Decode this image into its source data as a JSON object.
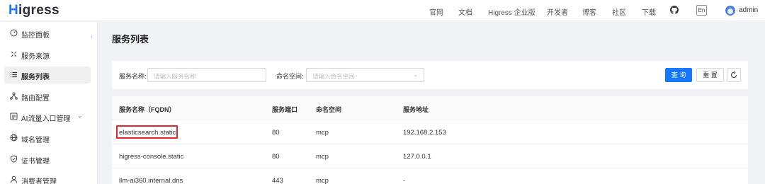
{
  "header": {
    "logo_first": "H",
    "logo_rest": "igress",
    "nav": [
      "官网",
      "文档",
      "Higress 企业版",
      "开发者",
      "博客",
      "社区",
      "下载"
    ],
    "github_icon": "github-icon",
    "lang_label": "En",
    "username": "admin"
  },
  "sidebar": {
    "items": [
      {
        "label": "监控面板",
        "icon": "dashboard-icon"
      },
      {
        "label": "服务来源",
        "icon": "service-source-icon"
      },
      {
        "label": "服务列表",
        "icon": "list-icon"
      },
      {
        "label": "路由配置",
        "icon": "route-icon"
      },
      {
        "label": "AI流量入口管理",
        "icon": "ai-icon"
      },
      {
        "label": "域名管理",
        "icon": "globe-icon"
      },
      {
        "label": "证书管理",
        "icon": "shield-icon"
      },
      {
        "label": "消费者管理",
        "icon": "user-icon"
      }
    ],
    "active": "服务列表"
  },
  "main": {
    "title": "服务列表",
    "filter": {
      "name_label": "服务名称:",
      "name_placeholder": "请输入服务名称",
      "ns_label": "命名空间:",
      "ns_placeholder": "请输入命名空间",
      "search_btn": "查 询",
      "reset_btn": "重 置"
    },
    "table": {
      "columns": [
        "服务名称（FQDN）",
        "服务端口",
        "命名空间",
        "服务地址"
      ],
      "rows": [
        [
          "elasticsearch.static",
          "80",
          "mcp",
          "192.168.2.153"
        ],
        [
          "higress-console.static",
          "80",
          "mcp",
          "127.0.0.1"
        ],
        [
          "llm-ai360.internal.dns",
          "443",
          "mcp",
          "-"
        ]
      ]
    }
  },
  "colors": {
    "accent": "#1677ff",
    "highlight": "#e0272c"
  }
}
